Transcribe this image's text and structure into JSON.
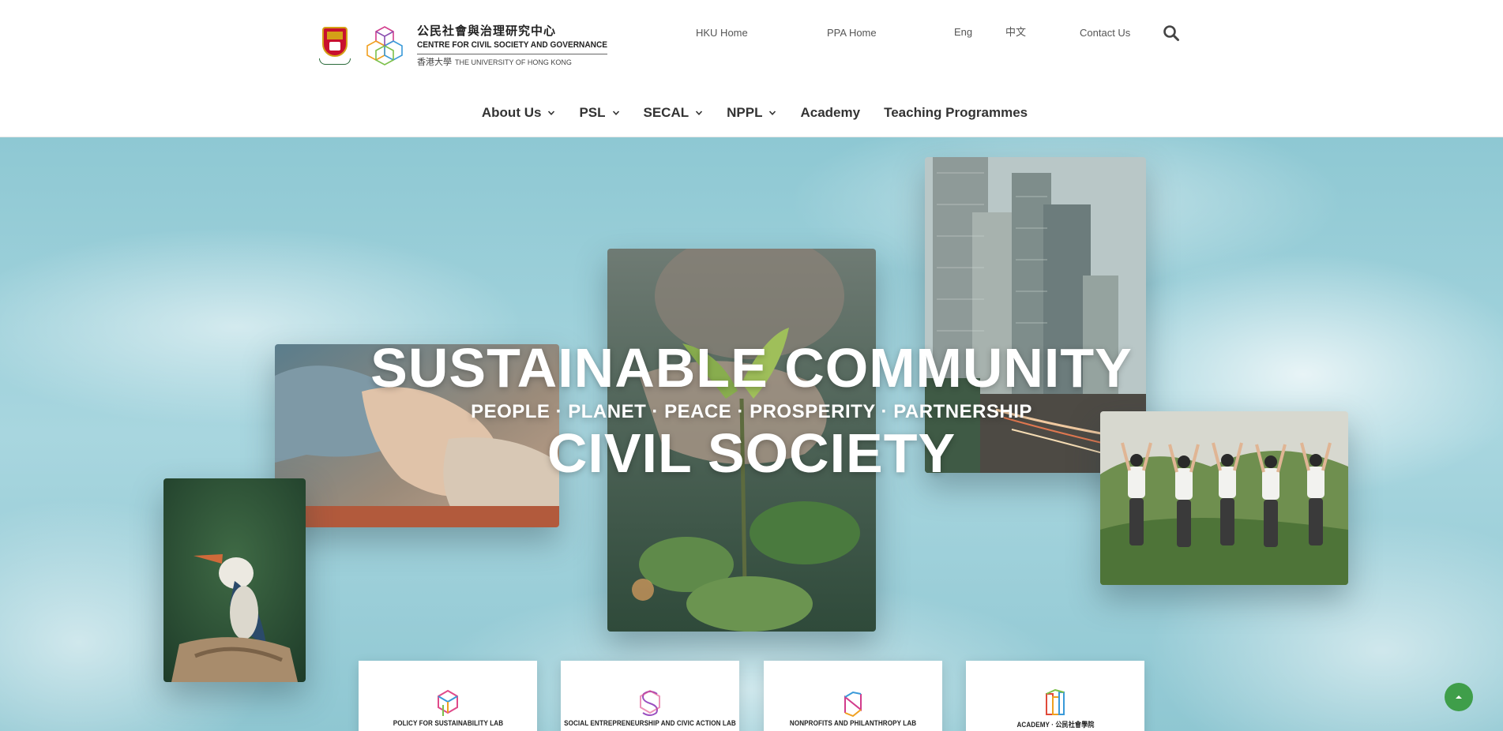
{
  "logo": {
    "chinese_name": "公民社會與治理研究中心",
    "english_name": "CENTRE FOR CIVIL SOCIETY AND GOVERNANCE",
    "university_chinese": "香港大學",
    "university_english": "THE UNIVERSITY OF HONG KONG"
  },
  "utility_nav": {
    "hku_home": "HKU Home",
    "ppa_home": "PPA Home",
    "eng": "Eng",
    "chinese": "中文",
    "contact_us": "Contact Us",
    "search_icon": "search-icon"
  },
  "main_nav": [
    {
      "label": "About Us",
      "has_dropdown": true
    },
    {
      "label": "PSL",
      "has_dropdown": true
    },
    {
      "label": "SECAL",
      "has_dropdown": true
    },
    {
      "label": "NPPL",
      "has_dropdown": true
    },
    {
      "label": "Academy",
      "has_dropdown": false
    },
    {
      "label": "Teaching Programmes",
      "has_dropdown": false
    }
  ],
  "hero": {
    "headline_1": "SUSTAINABLE COMMUNITY",
    "tagline": "PEOPLE · PLANET · PEACE · PROSPERITY · PARTNERSHIP",
    "headline_2": "CIVIL SOCIETY"
  },
  "lab_cards": [
    {
      "title": "POLICY FOR SUSTAINABILITY LAB"
    },
    {
      "title": "SOCIAL ENTREPRENEURSHIP AND CIVIC ACTION LAB"
    },
    {
      "title": "NONPROFITS AND PHILANTHROPY LAB"
    },
    {
      "title": "ACADEMY · 公民社會學院"
    }
  ],
  "colors": {
    "sky": "#a8d6df",
    "nav_text": "#333333",
    "back_to_top": "#3f9e4a"
  }
}
